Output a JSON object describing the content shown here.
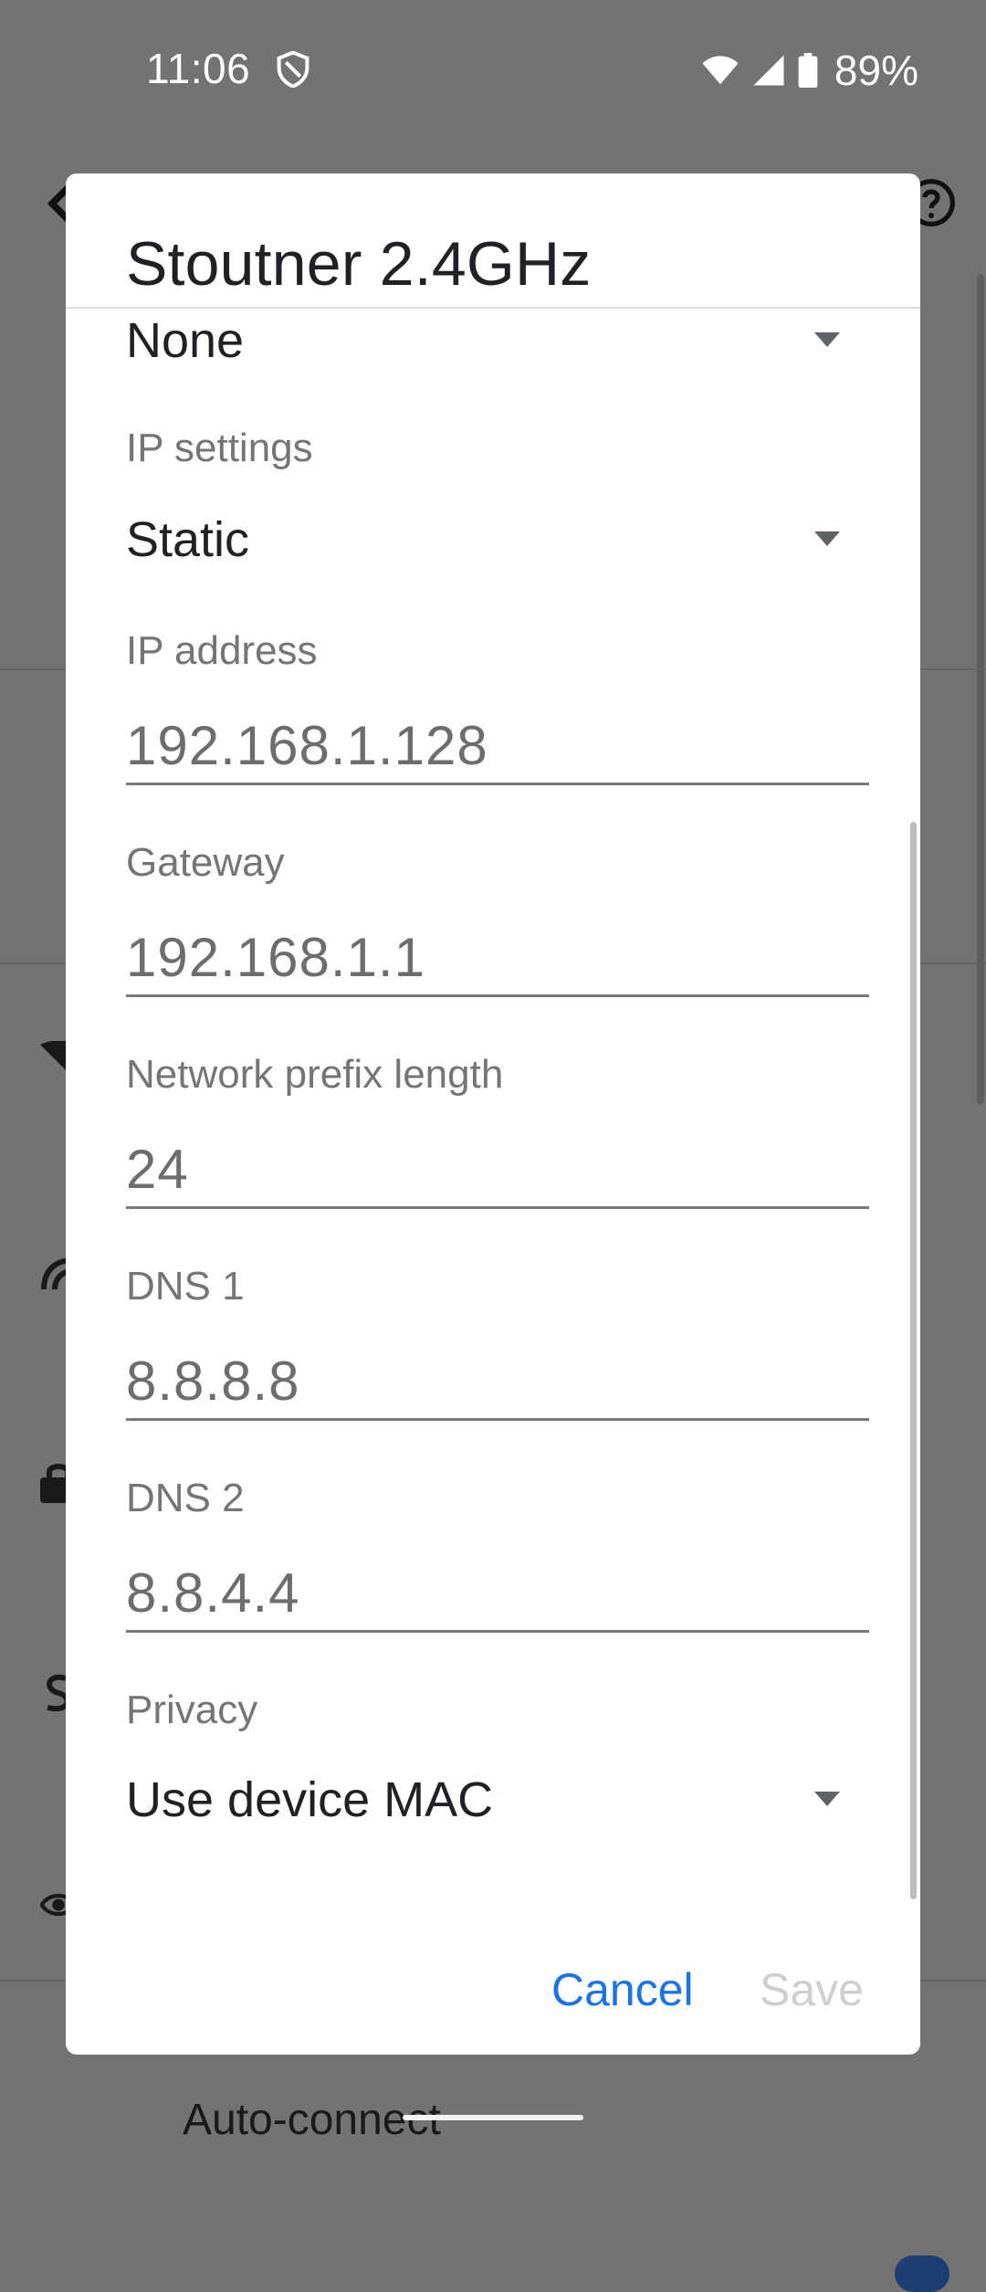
{
  "status_bar": {
    "time": "11:06",
    "battery_percent": "89%",
    "icons": [
      "shield-icon",
      "wifi-icon",
      "signal-icon",
      "battery-icon"
    ]
  },
  "background": {
    "auto_connect_label": "Auto-connect"
  },
  "dialog": {
    "title": "Stoutner 2.4GHz",
    "proxy": {
      "value": "None"
    },
    "ip_settings": {
      "label": "IP settings",
      "value": "Static"
    },
    "ip_address": {
      "label": "IP address",
      "value": "192.168.1.128"
    },
    "gateway": {
      "label": "Gateway",
      "value": "192.168.1.1"
    },
    "prefix_length": {
      "label": "Network prefix length",
      "value": "24"
    },
    "dns1": {
      "label": "DNS 1",
      "value": "8.8.8.8"
    },
    "dns2": {
      "label": "DNS 2",
      "value": "8.8.4.4"
    },
    "privacy": {
      "label": "Privacy",
      "value": "Use device MAC"
    },
    "buttons": {
      "cancel": "Cancel",
      "save": "Save"
    }
  },
  "colors": {
    "accent": "#1a73e8",
    "scrim": "#737373",
    "dialog_bg": "#ffffff",
    "disabled_text": "#cfcfcf"
  }
}
